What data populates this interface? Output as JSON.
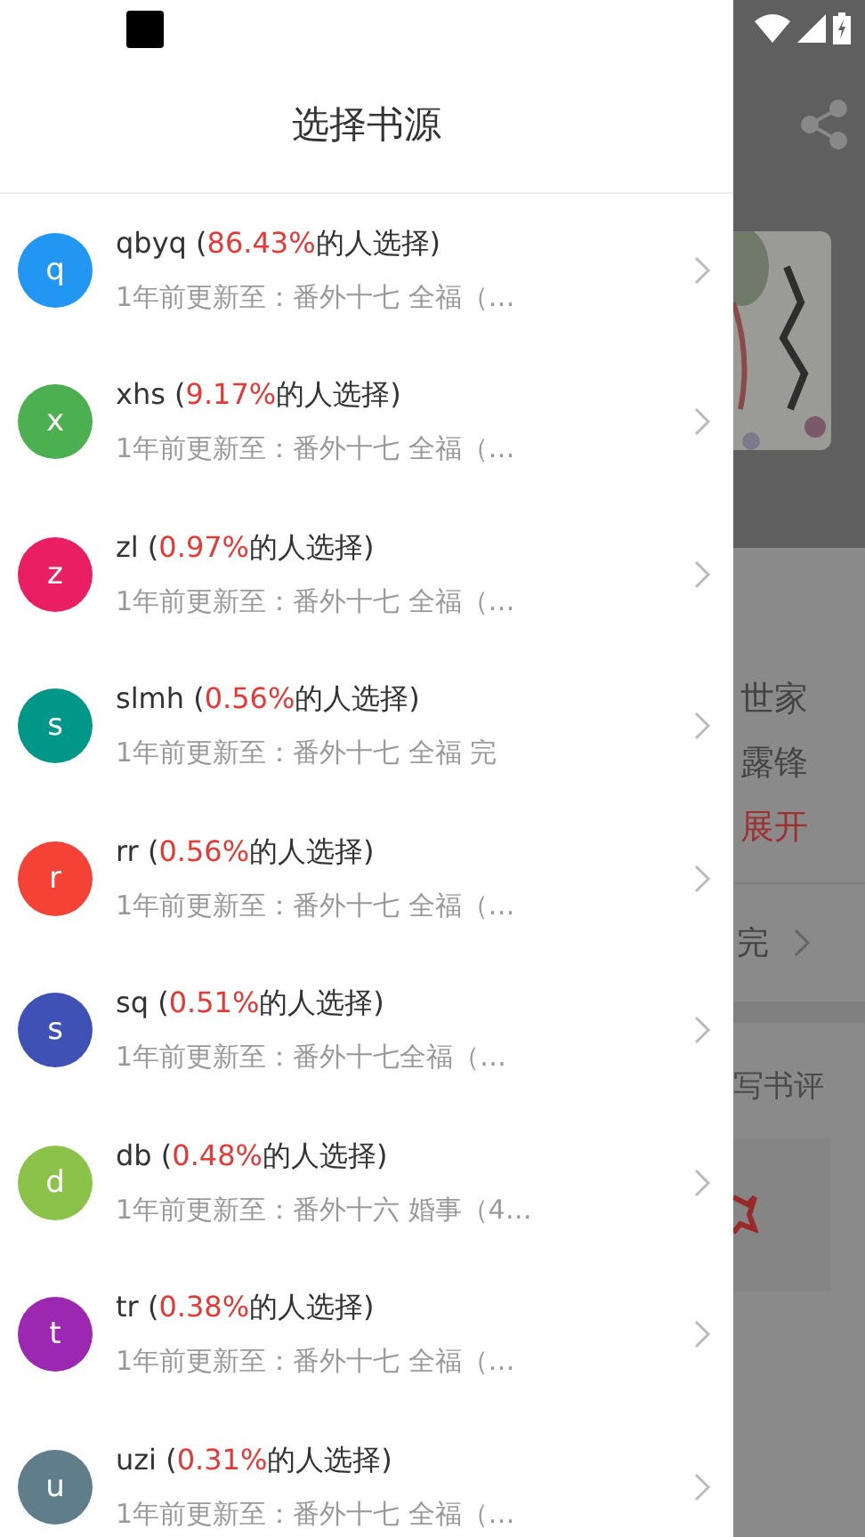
{
  "drawer": {
    "title": "选择书源",
    "sources": [
      {
        "letter": "q",
        "color": "#2196f3",
        "label_before": "qbyq (",
        "percent": "86.43%",
        "label_after": "的人选择)",
        "update": "1年前更新至：番外十七 全福（…"
      },
      {
        "letter": "x",
        "color": "#4caf50",
        "label_before": "xhs (",
        "percent": "9.17%",
        "label_after": "的人选择)",
        "update": "1年前更新至：番外十七 全福（…"
      },
      {
        "letter": "z",
        "color": "#e91e63",
        "label_before": "zl (",
        "percent": "0.97%",
        "label_after": "的人选择)",
        "update": "1年前更新至：番外十七 全福（…"
      },
      {
        "letter": "s",
        "color": "#009688",
        "label_before": "slmh (",
        "percent": "0.56%",
        "label_after": "的人选择)",
        "update": "1年前更新至：番外十七 全福 完"
      },
      {
        "letter": "r",
        "color": "#f44336",
        "label_before": "rr (",
        "percent": "0.56%",
        "label_after": "的人选择)",
        "update": "1年前更新至：番外十七 全福（…"
      },
      {
        "letter": "s",
        "color": "#3f51b5",
        "label_before": "sq (",
        "percent": "0.51%",
        "label_after": "的人选择)",
        "update": "1年前更新至：番外十七全福（…"
      },
      {
        "letter": "d",
        "color": "#8bc34a",
        "label_before": "db (",
        "percent": "0.48%",
        "label_after": "的人选择)",
        "update": "1年前更新至：番外十六 婚事（4…"
      },
      {
        "letter": "t",
        "color": "#9c27b0",
        "label_before": "tr (",
        "percent": "0.38%",
        "label_after": "的人选择)",
        "update": "1年前更新至：番外十七 全福（…"
      },
      {
        "letter": "u",
        "color": "#607d8b",
        "label_before": "uzi (",
        "percent": "0.31%",
        "label_after": "的人选择)",
        "update": "1年前更新至：番外十七 全福（…"
      }
    ]
  },
  "background_page": {
    "lines": [
      "世家",
      "露锋"
    ],
    "expand_link": "展开",
    "status": "完",
    "review_link": "写书评"
  }
}
